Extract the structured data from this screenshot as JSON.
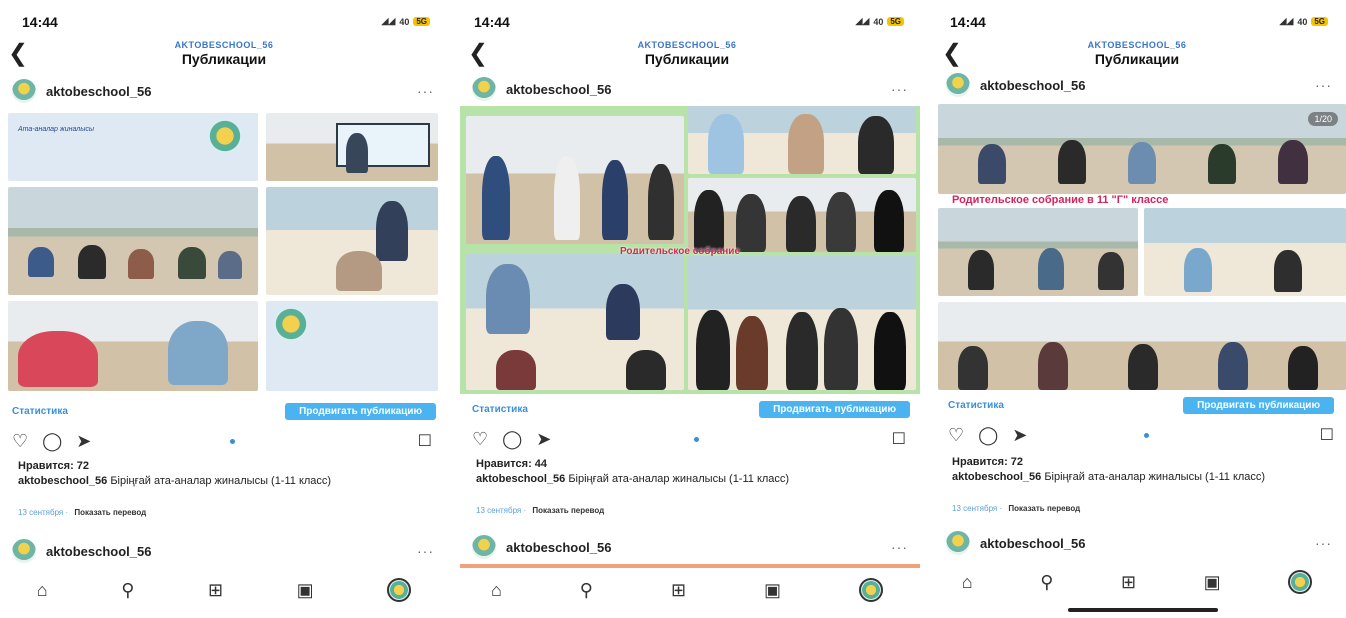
{
  "screens": [
    {
      "time": "14:44",
      "status_icons": "40",
      "battery": "5G",
      "account": "AKTOBESCHOOL_56",
      "title": "Публикации",
      "username": "aktobeschool_56",
      "stats_label": "Статистика",
      "promote_label": "Продвигать публикацию",
      "likes": "Нравится: 72",
      "caption_user": "aktobeschool_56",
      "caption_text": "Біріңғай ата-аналар жиналысы (1-11 класс)",
      "date": "13 сентября",
      "translate": "Показать перевод",
      "next_user": "aktobeschool_56"
    },
    {
      "time": "14:44",
      "status_icons": "40",
      "battery": "5G",
      "account": "AKTOBESCHOOL_56",
      "title": "Публикации",
      "username": "aktobeschool_56",
      "stats_label": "Статистика",
      "promote_label": "Продвигать публикацию",
      "likes": "Нравится: 44",
      "caption_user": "aktobeschool_56",
      "caption_text": "Біріңғай ата-аналар жиналысы (1-11 класс)",
      "date": "13 сентября",
      "translate": "Показать перевод",
      "next_user": "aktobeschool_56"
    },
    {
      "time": "14:44",
      "status_icons": "40",
      "battery": "5G",
      "account": "AKTOBESCHOOL_56",
      "title": "Публикации",
      "username": "aktobeschool_56",
      "stats_label": "Статистика",
      "promote_label": "Продвигать публикацию",
      "likes": "Нравится: 72",
      "caption_user": "aktobeschool_56",
      "caption_text": "Біріңғай ата-аналар жиналысы (1-11 класс)",
      "date": "13 сентября",
      "translate": "Показать перевод",
      "next_user": "aktobeschool_56"
    }
  ],
  "slide_text": "Ата-аналар жиналысы",
  "overlay_mid": "Родительское собрание",
  "overlay_right": "Родительское собрание в 11 \"Г\" классе",
  "counter_right": "1/20",
  "icons": {
    "back": "chevron-left-icon",
    "more": "more-icon",
    "like": "heart-icon",
    "comment": "comment-icon",
    "share": "send-icon",
    "save": "bookmark-icon",
    "home": "home-icon",
    "search": "search-icon",
    "create": "plus-square-icon",
    "reels": "reels-icon"
  },
  "colors": {
    "accent": "#3a8fd8",
    "promote": "#4ab3f0",
    "account": "#3a76c8"
  }
}
